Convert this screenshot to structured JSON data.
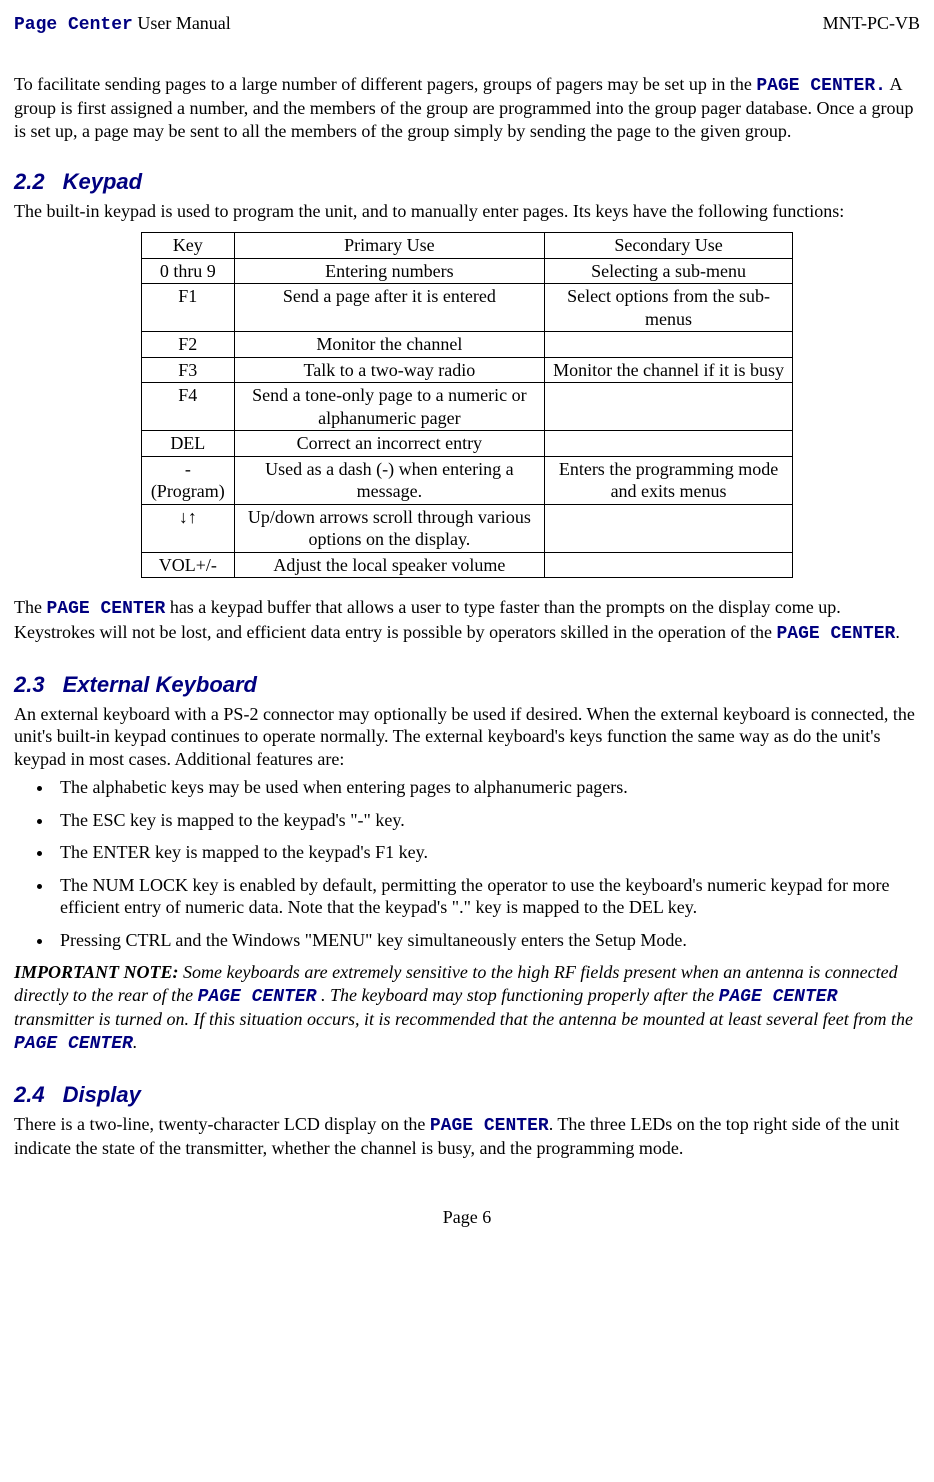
{
  "header": {
    "product": "Page Center",
    "doc": " User Manual",
    "code": "MNT-PC-VB"
  },
  "intro": {
    "part1": "To facilitate sending pages to a large number of different pagers, groups of pagers may be set up in the ",
    "pc1": "PAGE CENTER.",
    "part2": "  A group is first assigned a number, and the members of the group are programmed into the group pager database.  Once a group is set up, a page may be sent to all the members of the group simply by sending the page to the given group."
  },
  "s22": {
    "num": "2.2",
    "title": "Keypad",
    "lead": "The built-in keypad is used to program the unit, and to manually enter pages. Its keys have the following functions:",
    "cols": [
      "Key",
      "Primary Use",
      "Secondary Use"
    ],
    "rows": [
      [
        "0 thru 9",
        "Entering numbers",
        "Selecting a sub-menu"
      ],
      [
        "F1",
        "Send a page after it is entered",
        "Select options from the sub-menus"
      ],
      [
        "F2",
        "Monitor the channel",
        ""
      ],
      [
        "F3",
        "Talk to a two-way radio",
        "Monitor the channel if it is busy"
      ],
      [
        "F4",
        "Send a tone-only page to a numeric or alphanumeric pager",
        ""
      ],
      [
        "DEL",
        "Correct an incorrect entry",
        ""
      ],
      [
        "- (Program)",
        "Used as a dash (-) when entering a message.",
        "Enters the programming mode and exits menus"
      ],
      [
        "↓↑",
        "Up/down arrows scroll through various options on the display.",
        ""
      ],
      [
        "VOL+/-",
        "Adjust the local speaker volume",
        ""
      ]
    ],
    "after1": "The ",
    "after_pc": "PAGE CENTER",
    "after2": " has a keypad buffer that allows a user to type faster than the prompts on the display come up.  Keystrokes will not be lost, and efficient data entry is possible by operators skilled in the operation of the ",
    "after3": "."
  },
  "s23": {
    "num": "2.3",
    "title": "External Keyboard",
    "lead": "An external keyboard with a PS-2 connector may optionally be used if desired. When the external keyboard is connected, the unit's built-in keypad continues to operate normally.  The external keyboard's keys function the same way as do the unit's keypad in most cases.  Additional features are:",
    "bullets": [
      "The alphabetic keys may be used when entering pages to alphanumeric pagers.",
      "The ESC key is mapped to the keypad's \"-\" key.",
      "The ENTER key is mapped to the keypad's F1 key.",
      "The NUM LOCK key is enabled by default, permitting the operator to use the keyboard's numeric keypad for more efficient entry of numeric data.  Note that the keypad's \".\" key is mapped to the DEL key.",
      "Pressing CTRL and the Windows \"MENU\" key simultaneously enters the Setup Mode."
    ],
    "note_lead": "IMPORTANT NOTE:",
    "note1": "   Some keyboards are extremely sensitive to the high RF fields present when an antenna is connected directly to the rear of the ",
    "note_pc": "PAGE CENTER",
    "note2": " .  The keyboard may stop functioning properly after the ",
    "note3": " transmitter is turned on.  If this situation occurs, it is recommended that the antenna be mounted at least several feet from the ",
    "note4": "."
  },
  "s24": {
    "num": "2.4",
    "title": "Display",
    "part1": "There is a two-line, twenty-character LCD display on the ",
    "pc": "PAGE CENTER",
    "part2": ". The three LEDs on the top right side of the unit indicate the state of the transmitter, whether the channel is busy, and the programming mode."
  },
  "footer": "Page 6"
}
